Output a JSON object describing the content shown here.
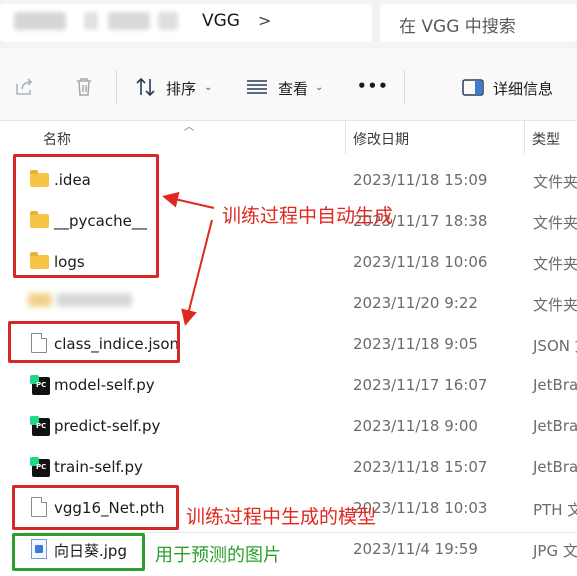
{
  "address": {
    "crumb": "VGG",
    "separator": ">"
  },
  "search": {
    "placeholder": "在 VGG 中搜索"
  },
  "toolbar": {
    "sort_label": "排序",
    "view_label": "查看",
    "more_label": "•••",
    "details_label": "详细信息"
  },
  "columns": {
    "name": "名称",
    "date": "修改日期",
    "type": "类型"
  },
  "rows": [
    {
      "name": ".idea",
      "date": "2023/11/18 15:09",
      "type": "文件夹",
      "icon": "folder-icon"
    },
    {
      "name": "__pycache__",
      "date": "2023/11/17 18:38",
      "type": "文件夹",
      "icon": "folder-icon"
    },
    {
      "name": "logs",
      "date": "2023/11/18 10:06",
      "type": "文件夹",
      "icon": "folder-icon"
    },
    {
      "name": "",
      "date": "2023/11/20 9:22",
      "type": "文件夹",
      "icon": "folder-icon"
    },
    {
      "name": "class_indice.json",
      "date": "2023/11/18 9:05",
      "type": "JSON 文",
      "icon": "document-icon"
    },
    {
      "name": "model-self.py",
      "date": "2023/11/17 16:07",
      "type": "JetBra",
      "icon": "pycharm-icon"
    },
    {
      "name": "predict-self.py",
      "date": "2023/11/18 9:00",
      "type": "JetBra",
      "icon": "pycharm-icon"
    },
    {
      "name": "train-self.py",
      "date": "2023/11/18 15:07",
      "type": "JetBra",
      "icon": "pycharm-icon"
    },
    {
      "name": "vgg16_Net.pth",
      "date": "2023/11/18 10:03",
      "type": "PTH 文",
      "icon": "document-icon"
    },
    {
      "name": "向日葵.jpg",
      "date": "2023/11/4 19:59",
      "type": "JPG 文",
      "icon": "image-icon"
    }
  ],
  "annotations": {
    "training_generated": "训练过程中自动生成",
    "model_generated": "训练过程中生成的模型",
    "prediction_image": "用于预测的图片"
  },
  "colors": {
    "annotation_red": "#d62728",
    "annotation_green": "#2ca02c",
    "folder": "#f6c544"
  }
}
